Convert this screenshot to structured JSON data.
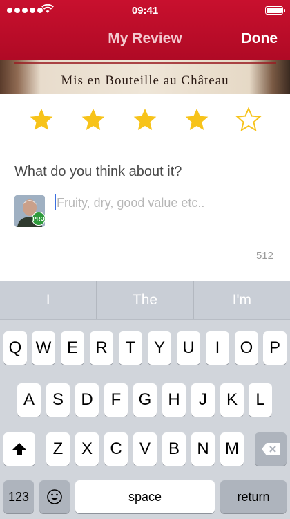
{
  "status_bar": {
    "time": "09:41"
  },
  "nav": {
    "title": "My Review",
    "done_label": "Done"
  },
  "wine_label": {
    "text": "Mis en Bouteille au Château"
  },
  "rating": {
    "value": 4,
    "max": 5
  },
  "review": {
    "prompt": "What do you think about it?",
    "placeholder": "Fruity, dry, good value etc..",
    "value": "",
    "chars_remaining": "512",
    "avatar_badge": "PRO"
  },
  "colors": {
    "brand": "#c8102e",
    "star": "#f7c31a",
    "badge": "#2e9a3c",
    "cursor": "#3b6fe0"
  },
  "keyboard": {
    "suggestions": [
      "I",
      "The",
      "I'm"
    ],
    "row1": [
      "Q",
      "W",
      "E",
      "R",
      "T",
      "Y",
      "U",
      "I",
      "O",
      "P"
    ],
    "row2": [
      "A",
      "S",
      "D",
      "F",
      "G",
      "H",
      "J",
      "K",
      "L"
    ],
    "row3": [
      "Z",
      "X",
      "C",
      "V",
      "B",
      "N",
      "M"
    ],
    "numbers_label": "123",
    "space_label": "space",
    "return_label": "return",
    "icons": {
      "shift": "shift-icon",
      "delete": "backspace-icon",
      "emoji": "emoji-icon"
    }
  }
}
